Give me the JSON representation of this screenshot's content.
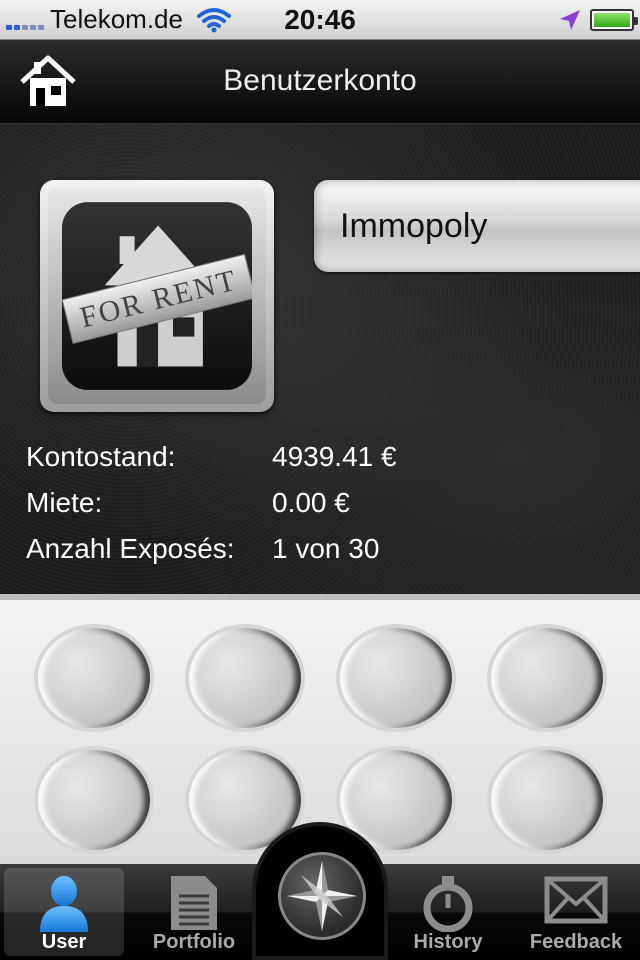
{
  "status_bar": {
    "carrier": "Telekom.de",
    "time": "20:46",
    "wifi_icon": "wifi-icon",
    "location_icon": "location-arrow-icon",
    "battery_level": 1.0
  },
  "nav": {
    "title": "Benutzerkonto",
    "home_icon": "house-icon"
  },
  "profile": {
    "avatar_icon": "for-rent-house-icon",
    "avatar_text": "FOR RENT",
    "name": "Immopoly"
  },
  "stats": [
    {
      "label": "Kontostand:",
      "value": "4939.41 €"
    },
    {
      "label": "Miete:",
      "value": "0.00 €"
    },
    {
      "label": "Anzahl Exposés:",
      "value": "1 von 30"
    }
  ],
  "badges": {
    "count": 8,
    "state": "empty"
  },
  "tabs": [
    {
      "label": "User",
      "icon": "user-icon",
      "active": true
    },
    {
      "label": "Portfolio",
      "icon": "document-icon",
      "active": false
    },
    {
      "label": "",
      "icon": "compass-icon",
      "active": false
    },
    {
      "label": "History",
      "icon": "stopwatch-icon",
      "active": false
    },
    {
      "label": "Feedback",
      "icon": "envelope-icon",
      "active": false
    }
  ],
  "colors": {
    "accent_blue": "#2a8ff0",
    "battery_green": "#2fa814",
    "location_purple": "#8a3fd1"
  }
}
